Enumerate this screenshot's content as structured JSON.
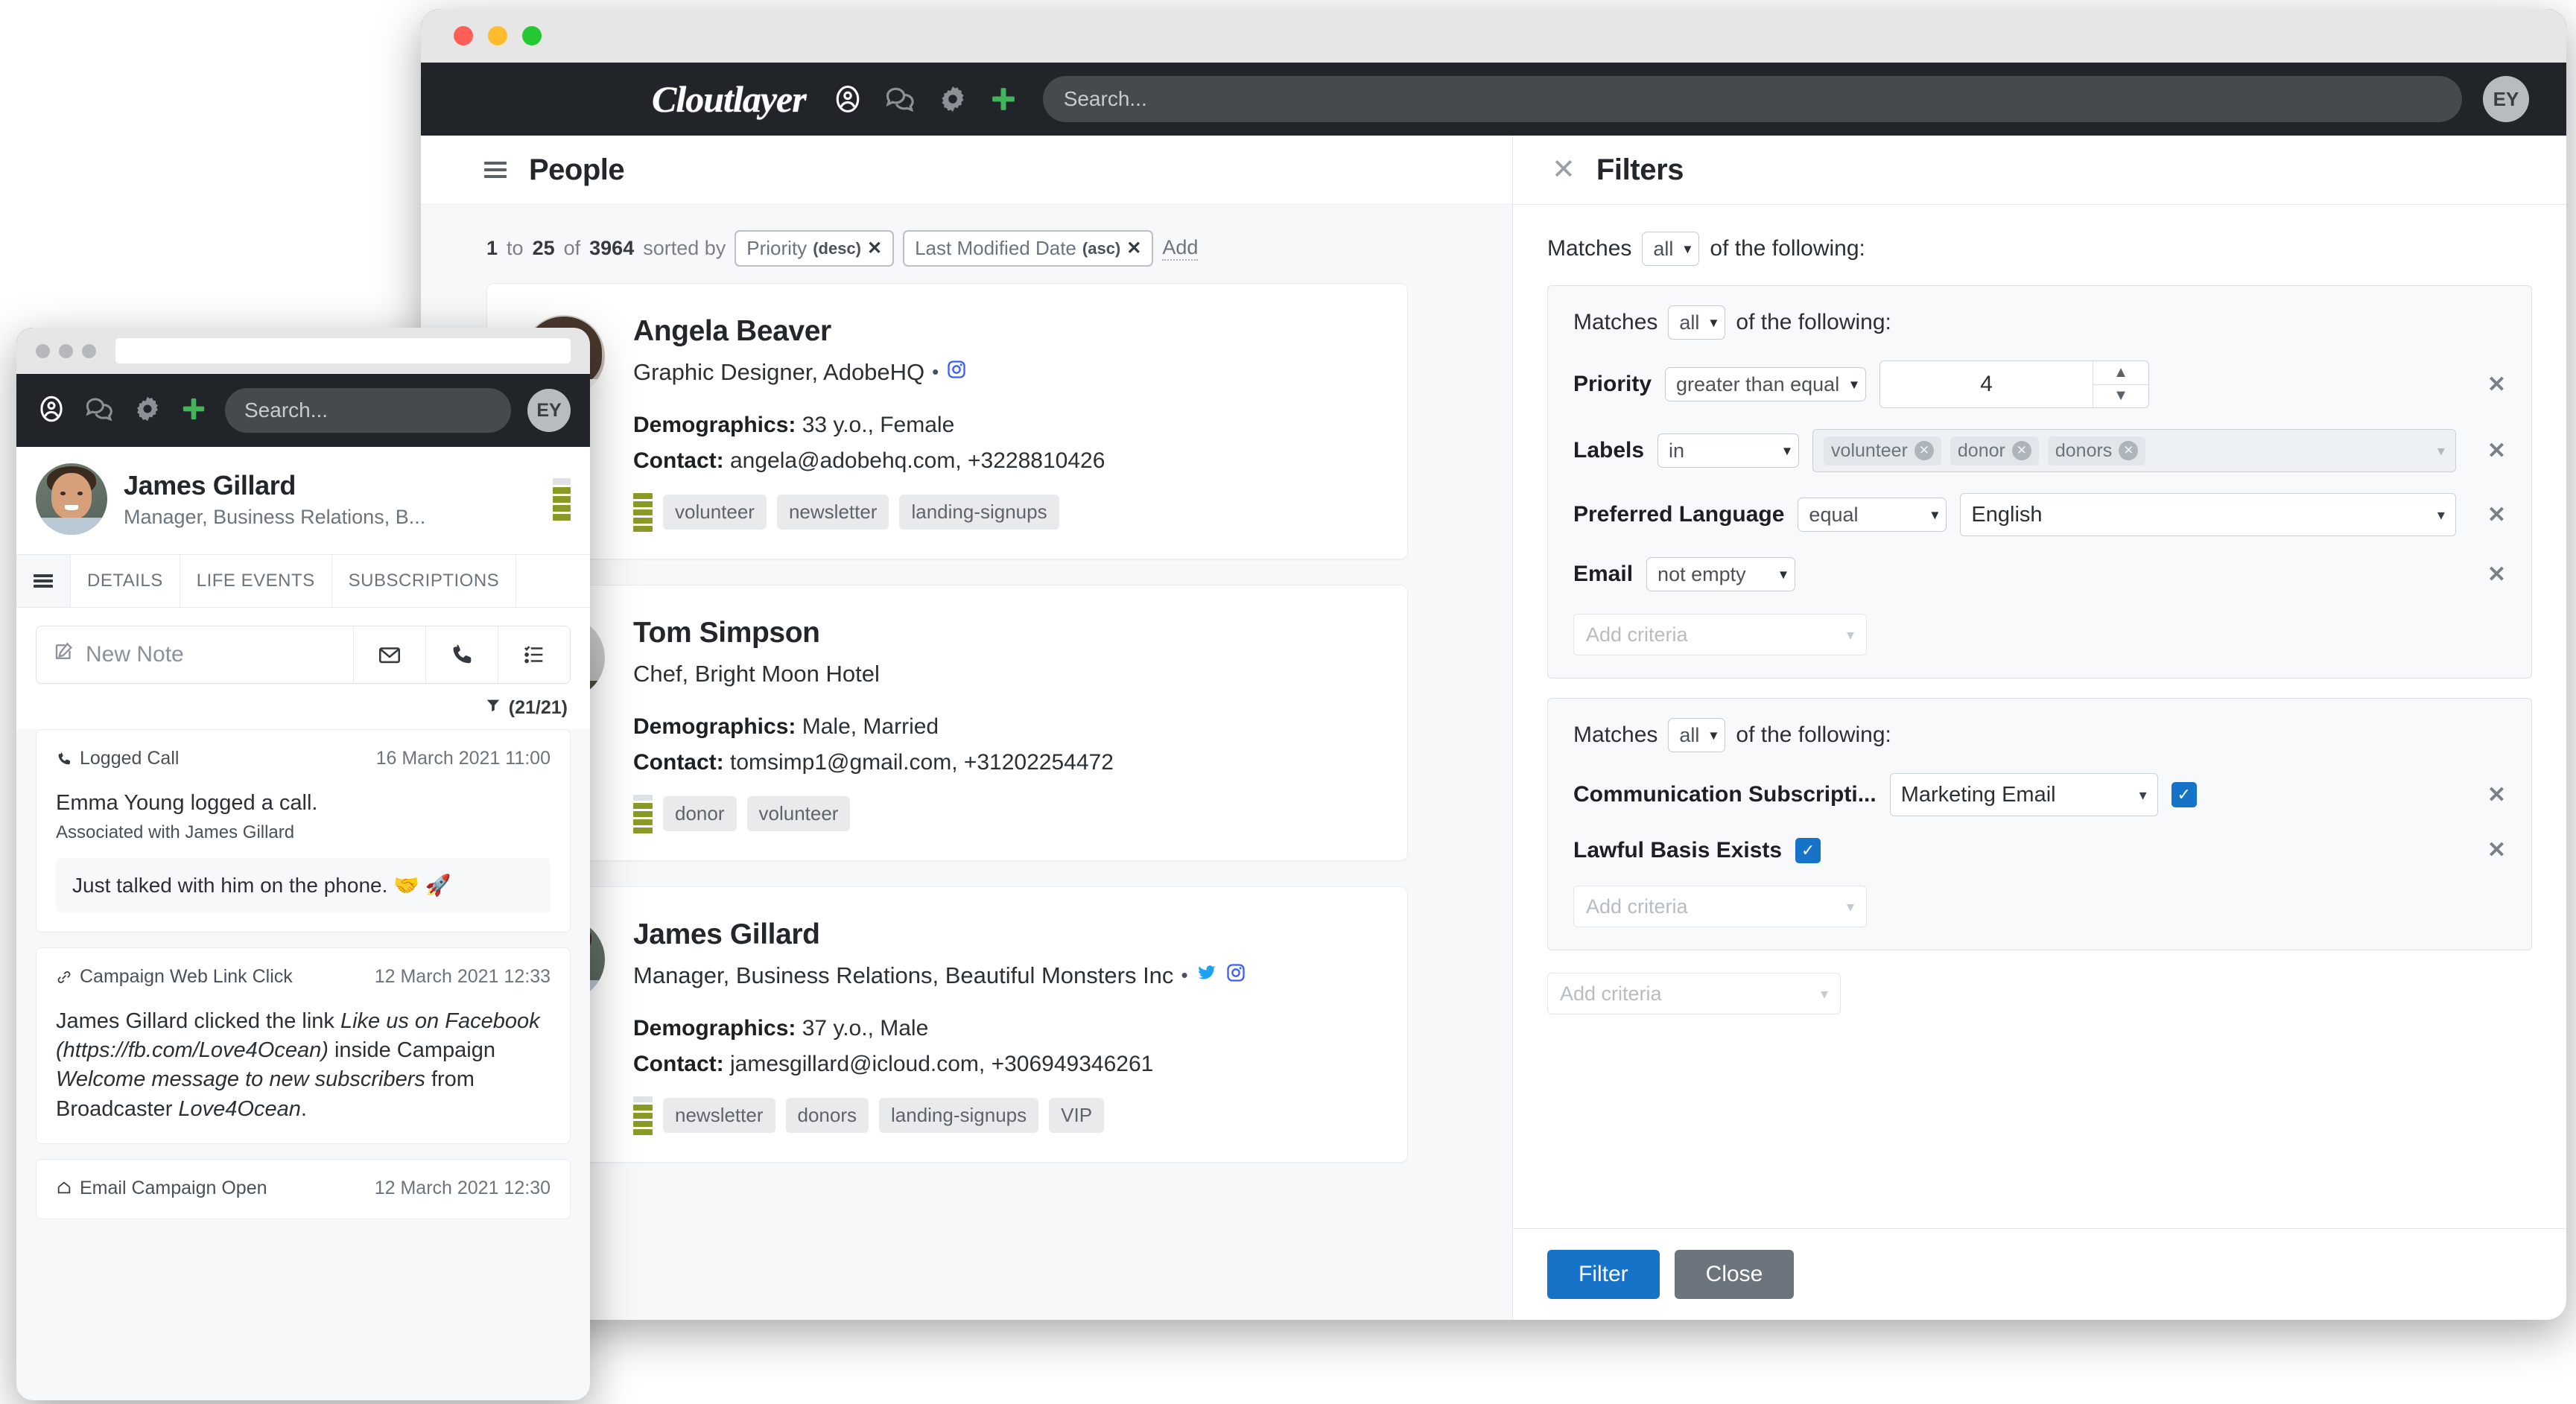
{
  "desktop": {
    "window_buttons": [
      "close",
      "minimize",
      "zoom"
    ],
    "topbar": {
      "brand": "Cloutlayer",
      "icons": [
        "account-icon",
        "chat-icon",
        "gear-icon",
        "plus-icon"
      ],
      "search_placeholder": "Search...",
      "avatar_initials": "EY"
    },
    "people": {
      "menu_icon": "hamburger-icon",
      "title": "People",
      "summary": {
        "from": "1",
        "to_label": "to",
        "to": "25",
        "of_label": "of",
        "total": "3964",
        "sorted_by_label": "sorted by",
        "sorts": [
          {
            "field": "Priority",
            "direction": "(desc)",
            "remove": "✕"
          },
          {
            "field": "Last Modified Date",
            "direction": "(asc)",
            "remove": "✕"
          }
        ],
        "add_label": "Add"
      },
      "cards": [
        {
          "name": "Angela Beaver",
          "role": "Graphic Designer, AdobeHQ",
          "separator": "•",
          "socials": [
            "instagram-icon"
          ],
          "demographics_label": "Demographics:",
          "demographics": "33 y.o., Female",
          "contact_label": "Contact:",
          "contact": "angela@adobehq.com, +3228810426",
          "priority_filled": 5,
          "priority_total": 5,
          "tags": [
            "volunteer",
            "newsletter",
            "landing-signups"
          ]
        },
        {
          "name": "Tom Simpson",
          "role": "Chef, Bright Moon Hotel",
          "separator": "",
          "socials": [],
          "demographics_label": "Demographics:",
          "demographics": "Male, Married",
          "contact_label": "Contact:",
          "contact": "tomsimp1@gmail.com, +31202254472",
          "priority_filled": 4,
          "priority_total": 5,
          "tags": [
            "donor",
            "volunteer"
          ]
        },
        {
          "name": "James Gillard",
          "role": "Manager, Business Relations, Beautiful Monsters Inc",
          "separator": "•",
          "socials": [
            "twitter-icon",
            "instagram-icon"
          ],
          "demographics_label": "Demographics:",
          "demographics": "37 y.o., Male",
          "contact_label": "Contact:",
          "contact": "jamesgillard@icloud.com, +306949346261",
          "priority_filled": 4,
          "priority_total": 5,
          "tags": [
            "newsletter",
            "donors",
            "landing-signups",
            "VIP"
          ]
        }
      ]
    },
    "filters": {
      "close_icon": "close-icon",
      "title": "Filters",
      "root_matches_prefix": "Matches",
      "root_matches_value": "all",
      "root_matches_suffix": "of the following:",
      "groups": [
        {
          "matches_prefix": "Matches",
          "matches_value": "all",
          "matches_suffix": "of the following:",
          "criteria": [
            {
              "label": "Priority",
              "operator": "greater than equal",
              "value": "4",
              "type": "number-stepper",
              "up_icon": "chevron-up-icon",
              "down_icon": "chevron-down-icon",
              "remove": "✕"
            },
            {
              "label": "Labels",
              "operator": "in",
              "chips": [
                "volunteer",
                "donor",
                "donors"
              ],
              "chip_remove": "✕",
              "type": "multiselect",
              "remove": "✕"
            },
            {
              "label": "Preferred Language",
              "operator": "equal",
              "value": "English",
              "type": "select",
              "remove": "✕"
            },
            {
              "label": "Email",
              "operator": "not empty",
              "type": "operator-only",
              "remove": "✕"
            }
          ],
          "add_criteria_placeholder": "Add criteria"
        },
        {
          "matches_prefix": "Matches",
          "matches_value": "all",
          "matches_suffix": "of the following:",
          "criteria": [
            {
              "label": "Communication Subscripti...",
              "value": "Marketing Email",
              "type": "select-checkbox",
              "checked": true,
              "check_glyph": "✓",
              "remove": "✕"
            },
            {
              "label": "Lawful Basis Exists",
              "type": "checkbox",
              "checked": true,
              "check_glyph": "✓",
              "remove": "✕"
            }
          ],
          "add_criteria_placeholder": "Add criteria"
        }
      ],
      "outer_add_criteria_placeholder": "Add criteria",
      "footer": {
        "filter_label": "Filter",
        "close_label": "Close",
        "filter_color": "#1673c8",
        "close_color": "#6c757d"
      }
    }
  },
  "mobile": {
    "window_buttons": [
      "dot",
      "dot",
      "dot"
    ],
    "url_value": "",
    "topbar": {
      "icons": [
        "account-icon",
        "chat-icon",
        "gear-icon",
        "plus-icon"
      ],
      "search_placeholder": "Search...",
      "avatar_initials": "EY"
    },
    "profile": {
      "name": "James Gillard",
      "role": "Manager, Business Relations, B...",
      "priority_filled": 4,
      "priority_total": 5
    },
    "tabs": [
      {
        "label": "",
        "icon": "hamburger-icon",
        "active": true
      },
      {
        "label": "DETAILS",
        "active": false
      },
      {
        "label": "LIFE EVENTS",
        "active": false
      },
      {
        "label": "SUBSCRIPTIONS",
        "active": false
      }
    ],
    "note_bar": {
      "placeholder": "New Note",
      "edit_icon": "compose-icon",
      "buttons": [
        "envelope-icon",
        "phone-icon",
        "task-list-icon"
      ]
    },
    "filter_count": {
      "icon": "funnel-icon",
      "label": "(21/21)"
    },
    "timeline": [
      {
        "icon": "phone-icon",
        "type": "Logged Call",
        "date": "16 March 2021 11:00",
        "text": "Emma Young logged a call.",
        "subtext": "Associated with James Gillard",
        "quote": "Just talked with him on the phone. 🤝 🚀"
      },
      {
        "icon": "link-icon",
        "type": "Campaign Web Link Click",
        "date": "12 March 2021 12:33",
        "text_parts": [
          {
            "t": "James Gillard clicked the link ",
            "i": false
          },
          {
            "t": "Like us on Facebook (https://fb.com/Love4Ocean)",
            "i": true
          },
          {
            "t": " inside Campaign ",
            "i": false
          },
          {
            "t": "Welcome message to new subscribers",
            "i": true
          },
          {
            "t": " from Broadcaster ",
            "i": false
          },
          {
            "t": "Love4Ocean",
            "i": true
          },
          {
            "t": ".",
            "i": false
          }
        ]
      },
      {
        "icon": "open-envelope-icon",
        "type": "Email Campaign Open",
        "date": "12 March 2021 12:30"
      }
    ]
  },
  "colors": {
    "topbar_bg": "#212529",
    "accent_green": "#45b35a",
    "priority_olive": "#8a9a26",
    "primary_blue": "#1673c8"
  }
}
